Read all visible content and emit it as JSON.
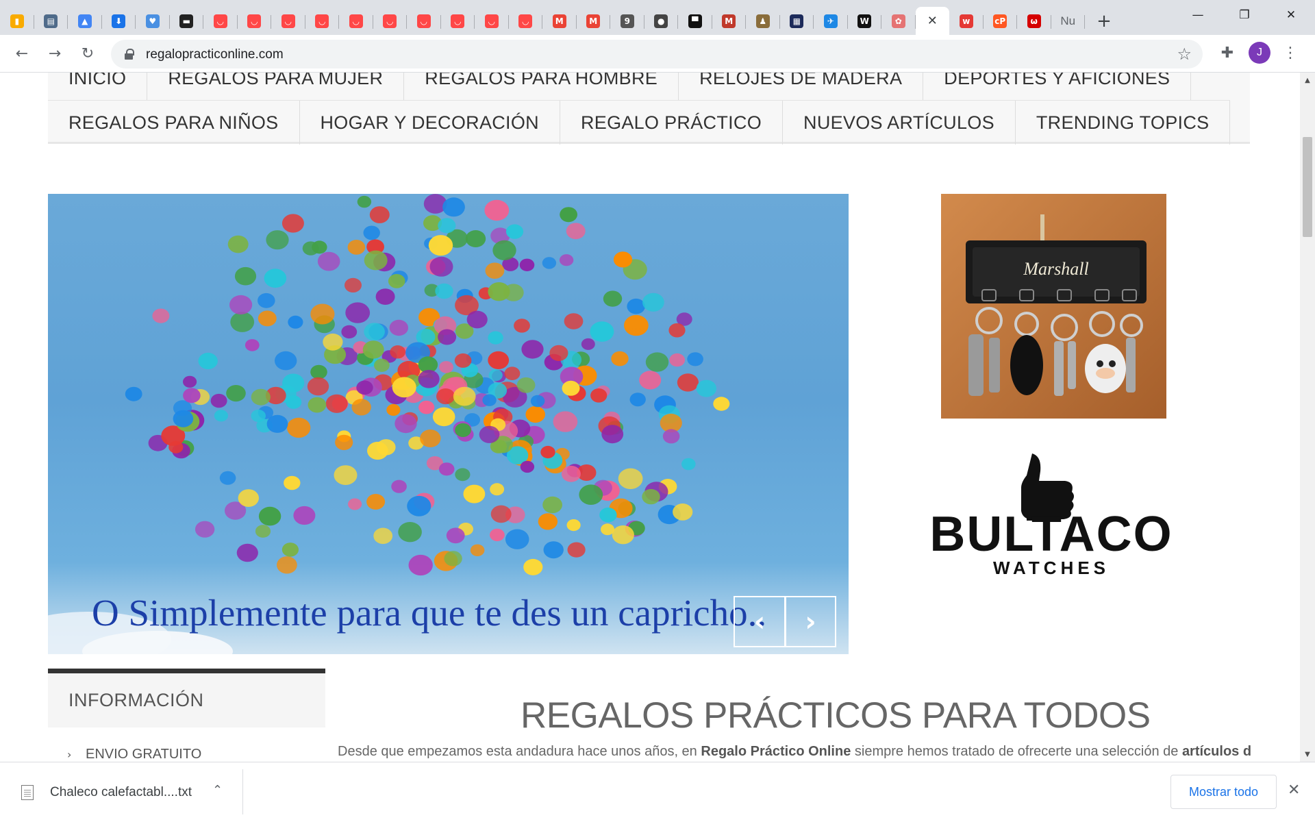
{
  "browser": {
    "tabs": [
      {
        "icon": "analytics-icon",
        "glyph": "▮",
        "color": "#f9ab00",
        "text": "",
        "active": false
      },
      {
        "icon": "calendar-icon",
        "glyph": "▤",
        "color": "#4f6b8a",
        "text": "",
        "active": false
      },
      {
        "icon": "google-ads-icon",
        "glyph": "▲",
        "color": "#4285f4",
        "text": "",
        "active": false
      },
      {
        "icon": "download-icon",
        "glyph": "⬇",
        "color": "#1a73e8",
        "text": "",
        "active": false
      },
      {
        "icon": "heart-icon",
        "glyph": "♥",
        "color": "#4a90e2",
        "text": "",
        "active": false
      },
      {
        "icon": "hat-icon",
        "glyph": "▬",
        "color": "#222222",
        "text": "",
        "active": false
      },
      {
        "icon": "aliexpress-icon",
        "glyph": "◡",
        "color": "#ff4747",
        "text": "",
        "active": false
      },
      {
        "icon": "aliexpress-icon",
        "glyph": "◡",
        "color": "#ff4747",
        "text": "",
        "active": false
      },
      {
        "icon": "aliexpress-icon",
        "glyph": "◡",
        "color": "#ff4747",
        "text": "",
        "active": false
      },
      {
        "icon": "aliexpress-icon",
        "glyph": "◡",
        "color": "#ff4747",
        "text": "",
        "active": false
      },
      {
        "icon": "aliexpress-icon",
        "glyph": "◡",
        "color": "#ff4747",
        "text": "",
        "active": false
      },
      {
        "icon": "aliexpress-icon",
        "glyph": "◡",
        "color": "#ff4747",
        "text": "",
        "active": false
      },
      {
        "icon": "aliexpress-icon",
        "glyph": "◡",
        "color": "#ff4747",
        "text": "",
        "active": false
      },
      {
        "icon": "aliexpress-icon",
        "glyph": "◡",
        "color": "#ff4747",
        "text": "",
        "active": false
      },
      {
        "icon": "aliexpress-icon",
        "glyph": "◡",
        "color": "#ff4747",
        "text": "",
        "active": false
      },
      {
        "icon": "aliexpress-icon",
        "glyph": "◡",
        "color": "#ff4747",
        "text": "",
        "active": false
      },
      {
        "icon": "gmail-icon",
        "glyph": "M",
        "color": "#ea4335",
        "text": "",
        "active": false
      },
      {
        "icon": "gmail-icon",
        "glyph": "M",
        "color": "#ea4335",
        "text": "",
        "active": false
      },
      {
        "icon": "notification-icon",
        "glyph": "9",
        "color": "#555555",
        "text": "",
        "active": false
      },
      {
        "icon": "face-icon",
        "glyph": "●",
        "color": "#444444",
        "text": "",
        "active": false
      },
      {
        "icon": "blocks-icon",
        "glyph": "▀",
        "color": "#111111",
        "text": "",
        "active": false
      },
      {
        "icon": "m-logo-icon",
        "glyph": "M",
        "color": "#c0392b",
        "text": "",
        "active": false
      },
      {
        "icon": "figure-icon",
        "glyph": "♟",
        "color": "#8a6d3b",
        "text": "",
        "active": false
      },
      {
        "icon": "game-icon",
        "glyph": "▦",
        "color": "#1c2a5a",
        "text": "",
        "active": false
      },
      {
        "icon": "bird-icon",
        "glyph": "✈",
        "color": "#1e88e5",
        "text": "",
        "active": false
      },
      {
        "icon": "w-logo-icon",
        "glyph": "W",
        "color": "#111111",
        "text": "",
        "active": false
      },
      {
        "icon": "site-icon",
        "glyph": "✿",
        "color": "#e57373",
        "text": "",
        "active": false
      },
      {
        "icon": "close-icon",
        "glyph": "✕",
        "color": "",
        "text": "",
        "active": true
      },
      {
        "icon": "w-red-icon",
        "glyph": "w",
        "color": "#e53935",
        "text": "",
        "active": false
      },
      {
        "icon": "cp-icon",
        "glyph": "cP",
        "color": "#ff5722",
        "text": "",
        "active": false
      },
      {
        "icon": "w-circle-icon",
        "glyph": "ω",
        "color": "#d50000",
        "text": "",
        "active": false
      },
      {
        "icon": "",
        "glyph": "",
        "color": "",
        "text": "Nu",
        "active": false
      }
    ],
    "url": "regalopracticonline.com"
  },
  "menu": {
    "row1": [
      "INICIO",
      "REGALOS PARA MUJER",
      "REGALOS PARA HOMBRE",
      "RELOJES DE MADERA",
      "DEPORTES Y AFICIONES"
    ],
    "row2": [
      "REGALOS PARA NIÑOS",
      "HOGAR Y DECORACIÓN",
      "REGALO PRÁCTICO",
      "NUEVOS ARTÍCULOS",
      "TRENDING TOPICS"
    ]
  },
  "slider": {
    "caption": "O Simplemente para que te des un capricho..",
    "colors": [
      "#e53935",
      "#43a047",
      "#fdd835",
      "#1e88e5",
      "#8e24aa",
      "#fb8c00",
      "#f06292",
      "#26c6da",
      "#7cb342",
      "#ab47bc"
    ]
  },
  "sidebar": {
    "ad1_brand": "Marshall",
    "ad2_brand": "BULTACO",
    "ad2_sub": "WATCHES"
  },
  "info": {
    "title": "INFORMACIÓN",
    "link": "ENVIO GRATUITO"
  },
  "main": {
    "title": "REGALOS PRÁCTICOS PARA TODOS",
    "text_a": "Desde que empezamos esta andadura hace unos años, en ",
    "text_b": "Regalo Práctico Online",
    "text_c": " siempre hemos tratado de ofrecerte una selección de ",
    "text_d": "artículos de"
  },
  "downloads": {
    "file": "Chaleco calefactabl....txt",
    "show_all": "Mostrar todo"
  }
}
